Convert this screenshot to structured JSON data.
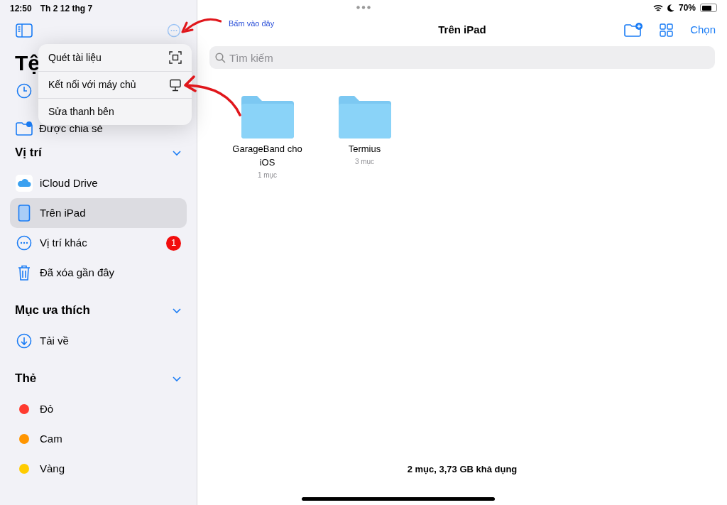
{
  "status_bar": {
    "time": "12:50",
    "date": "Th 2 12 thg 7",
    "battery": "70%"
  },
  "annotation": {
    "text": "Bấm vào đây"
  },
  "sidebar": {
    "title": "Tệ",
    "shared": "Được chia sẻ",
    "sections": [
      {
        "title": "Vị trí",
        "expanded": true,
        "items": [
          {
            "kind": "icloud",
            "label": "iCloud Drive",
            "selected": false
          },
          {
            "kind": "ipad",
            "label": "Trên iPad",
            "selected": true
          },
          {
            "kind": "more",
            "label": "Vị trí khác",
            "selected": false,
            "badge": "1"
          },
          {
            "kind": "trash",
            "label": "Đã xóa gần đây",
            "selected": false
          }
        ]
      },
      {
        "title": "Mục ưa thích",
        "expanded": true,
        "items": [
          {
            "kind": "download",
            "label": "Tải về",
            "selected": false
          }
        ]
      },
      {
        "title": "Thẻ",
        "expanded": true,
        "items": [
          {
            "kind": "tag",
            "label": "Đỏ",
            "color": "#ff3b30",
            "selected": false
          },
          {
            "kind": "tag",
            "label": "Cam",
            "color": "#ff9500",
            "selected": false
          },
          {
            "kind": "tag",
            "label": "Vàng",
            "color": "#ffcc00",
            "selected": false
          }
        ]
      }
    ]
  },
  "menu": {
    "items": [
      {
        "kind": "scan",
        "label": "Quét tài liệu"
      },
      {
        "kind": "server",
        "label": "Kết nối với máy chủ"
      },
      {
        "kind": "none",
        "label": "Sửa thanh bên"
      }
    ]
  },
  "main": {
    "title": "Trên iPad",
    "select_button": "Chọn",
    "search": {
      "placeholder": "Tìm kiếm"
    },
    "folders": [
      {
        "name": "GarageBand cho iOS",
        "count": "1 mục"
      },
      {
        "name": "Termius",
        "count": "3 mục"
      }
    ],
    "footer": "2 mục, 3,73 GB khả dụng"
  }
}
